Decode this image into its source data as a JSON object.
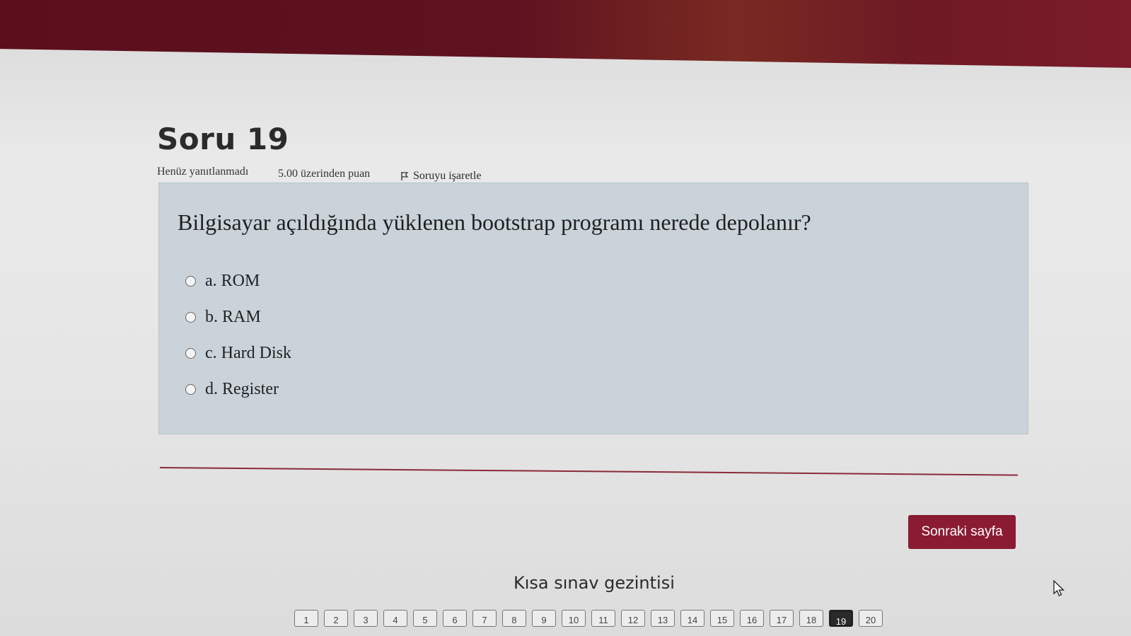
{
  "question": {
    "title": "Soru 19",
    "status": "Henüz yanıtlanmadı",
    "points": "5.00 üzerinden puan",
    "flag_label": "Soruyu işaretle",
    "text": "Bilgisayar açıldığında yüklenen bootstrap programı nerede depolanır?",
    "options": [
      {
        "label": "a. ROM"
      },
      {
        "label": "b. RAM"
      },
      {
        "label": "c. Hard Disk"
      },
      {
        "label": "d. Register"
      }
    ]
  },
  "next_button": "Sonraki sayfa",
  "navigation": {
    "title": "Kısa sınav gezintisi",
    "current": "19",
    "pages": [
      "1",
      "2",
      "3",
      "4",
      "5",
      "6",
      "7",
      "8",
      "9",
      "10",
      "11",
      "12",
      "13",
      "14",
      "15",
      "16",
      "17",
      "18",
      "19",
      "20"
    ]
  },
  "colors": {
    "brand": "#8b1b32",
    "header": "#5b0f1d",
    "question_bg": "#c9d3d9"
  }
}
